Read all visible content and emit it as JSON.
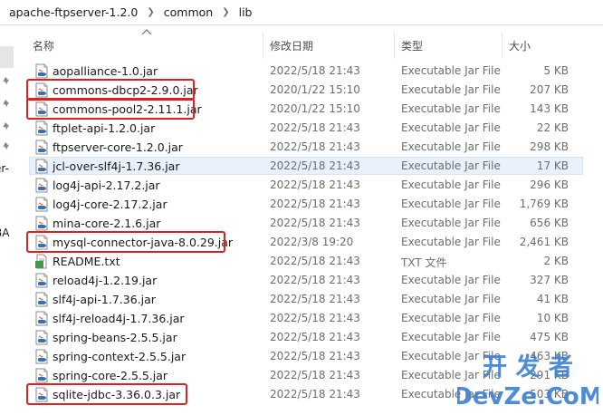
{
  "breadcrumb": [
    "apache-ftpserver-1.2.0",
    "common",
    "lib"
  ],
  "nav": {
    "fragments": [
      "er-",
      "BA"
    ]
  },
  "columns": {
    "name": "名称",
    "modified": "修改日期",
    "type": "类型",
    "size": "大小"
  },
  "files": [
    {
      "name": "aopalliance-1.0.jar",
      "date": "2022/5/18 21:43",
      "type": "Executable Jar File",
      "size": "5 KB",
      "icon": "jar-file-icon"
    },
    {
      "name": "commons-dbcp2-2.9.0.jar",
      "date": "2020/1/22 15:10",
      "type": "Executable Jar File",
      "size": "207 KB",
      "icon": "jar-file-icon"
    },
    {
      "name": "commons-pool2-2.11.1.jar",
      "date": "2020/1/22 15:10",
      "type": "Executable Jar File",
      "size": "143 KB",
      "icon": "jar-file-icon"
    },
    {
      "name": "ftplet-api-1.2.0.jar",
      "date": "2022/5/18 21:43",
      "type": "Executable Jar File",
      "size": "22 KB",
      "icon": "jar-file-icon"
    },
    {
      "name": "ftpserver-core-1.2.0.jar",
      "date": "2022/5/18 21:43",
      "type": "Executable Jar File",
      "size": "298 KB",
      "icon": "jar-file-icon"
    },
    {
      "name": "jcl-over-slf4j-1.7.36.jar",
      "date": "2022/5/18 21:43",
      "type": "Executable Jar File",
      "size": "17 KB",
      "icon": "jar-file-icon"
    },
    {
      "name": "log4j-api-2.17.2.jar",
      "date": "2022/5/18 21:43",
      "type": "Executable Jar File",
      "size": "296 KB",
      "icon": "jar-file-icon"
    },
    {
      "name": "log4j-core-2.17.2.jar",
      "date": "2022/5/18 21:43",
      "type": "Executable Jar File",
      "size": "1,769 KB",
      "icon": "jar-file-icon"
    },
    {
      "name": "mina-core-2.1.6.jar",
      "date": "2022/5/18 21:43",
      "type": "Executable Jar File",
      "size": "656 KB",
      "icon": "jar-file-icon"
    },
    {
      "name": "mysql-connector-java-8.0.29.jar",
      "date": "2022/3/8 19:20",
      "type": "Executable Jar File",
      "size": "2,461 KB",
      "icon": "jar-file-icon"
    },
    {
      "name": "README.txt",
      "date": "2022/5/18 21:43",
      "type": "TXT 文件",
      "size": "2 KB",
      "icon": "text-file-icon"
    },
    {
      "name": "reload4j-1.2.19.jar",
      "date": "2022/5/18 21:43",
      "type": "Executable Jar File",
      "size": "327 KB",
      "icon": "jar-file-icon"
    },
    {
      "name": "slf4j-api-1.7.36.jar",
      "date": "2022/5/18 21:43",
      "type": "Executable Jar File",
      "size": "41 KB",
      "icon": "jar-file-icon"
    },
    {
      "name": "slf4j-reload4j-1.7.36.jar",
      "date": "2022/5/18 21:43",
      "type": "Executable Jar File",
      "size": "10 KB",
      "icon": "jar-file-icon"
    },
    {
      "name": "spring-beans-2.5.5.jar",
      "date": "2022/5/18 21:43",
      "type": "Executable Jar File",
      "size": "475 KB",
      "icon": "jar-file-icon"
    },
    {
      "name": "spring-context-2.5.5.jar",
      "date": "2022/5/18 21:43",
      "type": "Executable Jar File",
      "size": "463 KB",
      "icon": "jar-file-icon"
    },
    {
      "name": "spring-core-2.5.5.jar",
      "date": "2022/5/18 21:43",
      "type": "Executable Jar File",
      "size": "291 KB",
      "icon": "jar-file-icon"
    },
    {
      "name": "sqlite-jdbc-3.36.0.3.jar",
      "date": "2022/5/18 21:43",
      "type": "Executable Jar File",
      "size": "503 KB",
      "icon": "jar-file-icon"
    }
  ],
  "selected_row": 5,
  "highlighted_rows": [
    1,
    2,
    9,
    17
  ],
  "watermark": {
    "line1": "开 发 者",
    "line2": "DevZe.CoM"
  },
  "colors": {
    "highlight": "#e02020",
    "selection": "#e8f1fb",
    "watermark": "#3b7fd4"
  }
}
